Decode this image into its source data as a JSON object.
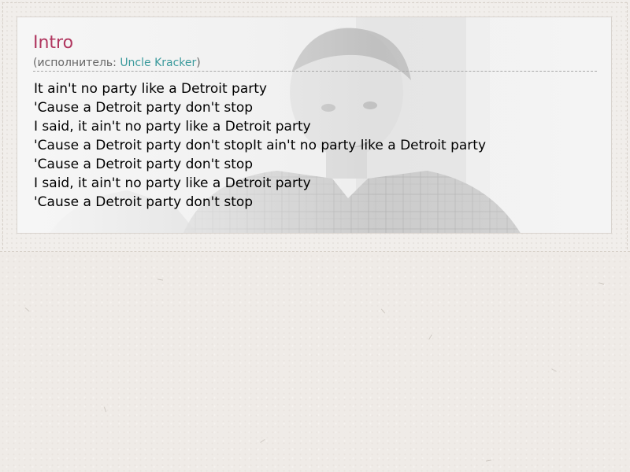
{
  "section": {
    "title": "Intro",
    "artist_prefix": "(исполнитель: ",
    "artist_name": "Uncle Kracker",
    "artist_suffix": ")"
  },
  "lyrics": [
    "It ain't no party like a Detroit party",
    "'Cause a Detroit party don't stop",
    "I said, it ain't no party like a Detroit party",
    "'Cause a Detroit party don't stopIt ain't no party like a Detroit party",
    "'Cause a Detroit party don't stop",
    "I said, it ain't no party like a Detroit party",
    "'Cause a Detroit party don't stop"
  ],
  "colors": {
    "title": "#b0365f",
    "artist_link": "#3b9a9c",
    "meta_text": "#666666",
    "lyric_text": "#000000",
    "page_background": "#efebe7"
  },
  "icons": {
    "background_photo": "singer-photo"
  }
}
